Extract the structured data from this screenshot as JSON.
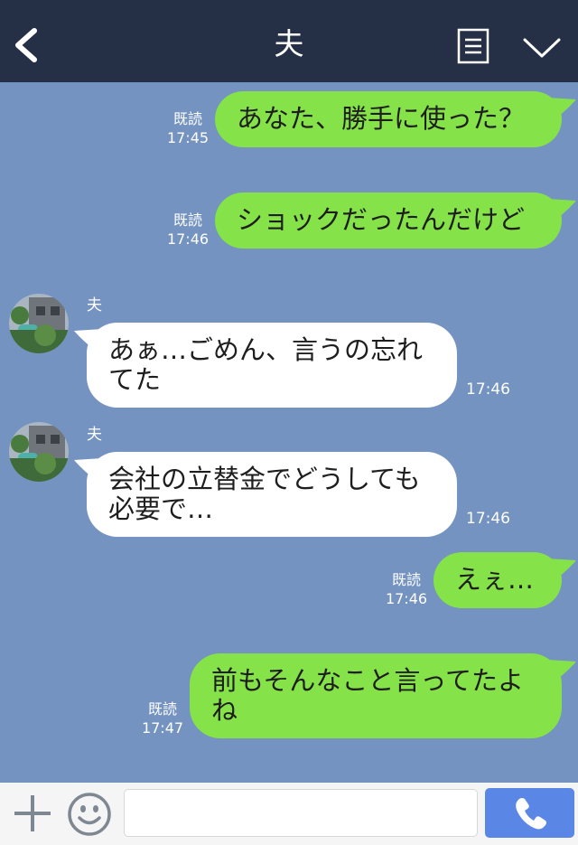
{
  "header": {
    "title": "夫",
    "back_icon": "chevron-left-icon",
    "menu_icon": "notes-icon",
    "dropdown_icon": "chevron-down-icon",
    "bg_color": "#253047"
  },
  "chat": {
    "bg_color": "#7493c1",
    "outgoing_color": "#85e249",
    "incoming_color": "#ffffff",
    "messages": [
      {
        "direction": "out",
        "text": [
          "あなた、勝手に使った？"
        ],
        "read": "既読",
        "time": "17:45"
      },
      {
        "direction": "out",
        "text": [
          "ショックだったんだけど"
        ],
        "read": "既読",
        "time": "17:46"
      },
      {
        "direction": "in",
        "sender": "夫",
        "text": [
          "あぁ…ごめん、言うの忘れ",
          "てた"
        ],
        "time": "17:46"
      },
      {
        "direction": "in",
        "sender": "夫",
        "text": [
          "会社の立替金でどうしても",
          "必要で…"
        ],
        "time": "17:46"
      },
      {
        "direction": "out",
        "text": [
          "えぇ…"
        ],
        "read": "既読",
        "time": "17:46"
      },
      {
        "direction": "out",
        "text": [
          "前もそんなこと言ってたよ",
          "ね"
        ],
        "read": "既読",
        "time": "17:47"
      }
    ]
  },
  "footer": {
    "plus_icon": "plus-icon",
    "emoji_icon": "smiley-icon",
    "message_input": {
      "value": "",
      "placeholder": ""
    },
    "call_icon": "phone-icon",
    "call_color": "#5a86e6"
  }
}
